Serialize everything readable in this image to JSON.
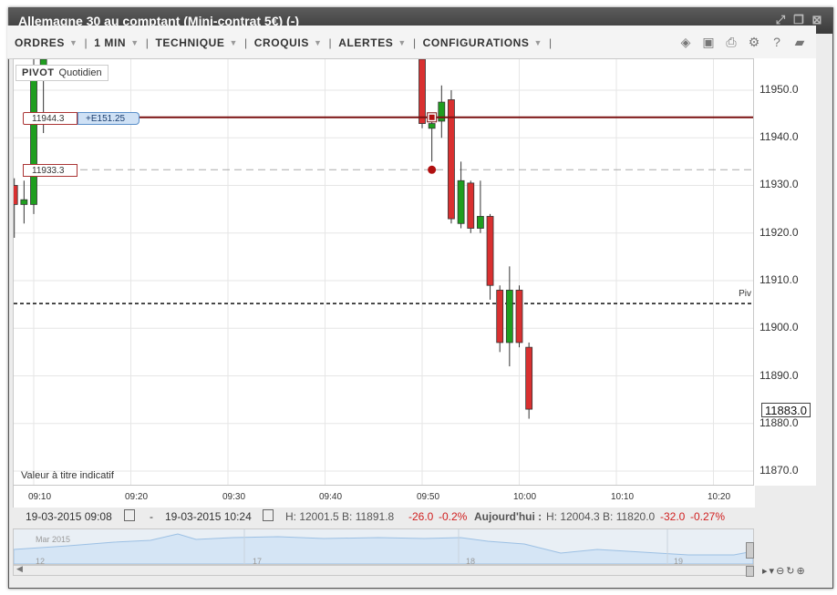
{
  "window": {
    "title": "Allemagne 30 au comptant (Mini-contrat 5€) (-)"
  },
  "toolbar": {
    "menus": [
      "ORDRES",
      "1 MIN",
      "TECHNIQUE",
      "CROQUIS",
      "ALERTES",
      "CONFIGURATIONS"
    ]
  },
  "overlay": {
    "pivot_label": "PIVOT",
    "pivot_period": "Quotidien",
    "pivot_line_label": "Piv",
    "indicative_note": "Valeur à titre indicatif",
    "position_price": "11944.3",
    "position_pnl": "+E151.25",
    "order_price": "11933.3"
  },
  "price_axis": {
    "ticks": [
      "11950.0",
      "11940.0",
      "11930.0",
      "11920.0",
      "11910.0",
      "11900.0",
      "11890.0",
      "11880.0",
      "11870.0"
    ],
    "current_price": "11883.0"
  },
  "time_axis": {
    "ticks": [
      "09:10",
      "09:20",
      "09:30",
      "09:40",
      "09:50",
      "10:00",
      "10:10",
      "10:20"
    ]
  },
  "info": {
    "from": "19-03-2015 09:08",
    "dash": "-",
    "to": "19-03-2015 10:24",
    "range": "H: 12001.5  B: 11891.8",
    "change": "-26.0",
    "change_pct": "-0.2%",
    "today_label": "Aujourd'hui :",
    "today_range": "H: 12004.3  B: 11820.0",
    "today_change": "-32.0",
    "today_change_pct": "-0.27%"
  },
  "navigator": {
    "month": "Mar 2015",
    "days": [
      "12",
      "17",
      "18",
      "19"
    ]
  },
  "colors": {
    "up": "#1f9e1f",
    "down": "#d93030",
    "position_line": "#7a1010",
    "accent_blue": "#cfe1f5"
  },
  "chart_data": {
    "type": "candlestick",
    "pivot": 11905.2,
    "position_level": 11944.3,
    "order_level": 11933.3,
    "ylim": [
      11863,
      11960
    ],
    "candles": [
      {
        "t": "09:08",
        "o": 11930.0,
        "h": 11931.5,
        "l": 11919.0,
        "c": 11926.0
      },
      {
        "t": "09:09",
        "o": 11926.0,
        "h": 11931.0,
        "l": 11922.0,
        "c": 11927.0
      },
      {
        "t": "09:10",
        "o": 11926.0,
        "h": 11960.0,
        "l": 11924.0,
        "c": 11952.0
      },
      {
        "t": "09:11",
        "o": 11952.0,
        "h": 11960.0,
        "l": 11941.0,
        "c": 11958.0
      },
      {
        "t": "09:50",
        "o": 11960.0,
        "h": 11960.0,
        "l": 11942.0,
        "c": 11943.0
      },
      {
        "t": "09:51",
        "o": 11942.0,
        "h": 11945.0,
        "l": 11935.0,
        "c": 11943.0
      },
      {
        "t": "09:52",
        "o": 11943.5,
        "h": 11951.0,
        "l": 11940.0,
        "c": 11947.5
      },
      {
        "t": "09:53",
        "o": 11948.0,
        "h": 11950.0,
        "l": 11922.0,
        "c": 11923.0
      },
      {
        "t": "09:54",
        "o": 11922.0,
        "h": 11935.0,
        "l": 11921.0,
        "c": 11931.0
      },
      {
        "t": "09:55",
        "o": 11930.5,
        "h": 11931.0,
        "l": 11920.0,
        "c": 11921.0
      },
      {
        "t": "09:56",
        "o": 11921.0,
        "h": 11931.0,
        "l": 11920.0,
        "c": 11923.5
      },
      {
        "t": "09:57",
        "o": 11923.5,
        "h": 11924.0,
        "l": 11906.0,
        "c": 11909.0
      },
      {
        "t": "09:58",
        "o": 11908.0,
        "h": 11909.0,
        "l": 11895.0,
        "c": 11897.0
      },
      {
        "t": "09:59",
        "o": 11897.0,
        "h": 11913.0,
        "l": 11892.0,
        "c": 11908.0
      },
      {
        "t": "10:00",
        "o": 11908.0,
        "h": 11909.0,
        "l": 11896.0,
        "c": 11897.0
      },
      {
        "t": "10:01",
        "o": 11896.0,
        "h": 11897.0,
        "l": 11881.0,
        "c": 11883.0
      }
    ]
  }
}
